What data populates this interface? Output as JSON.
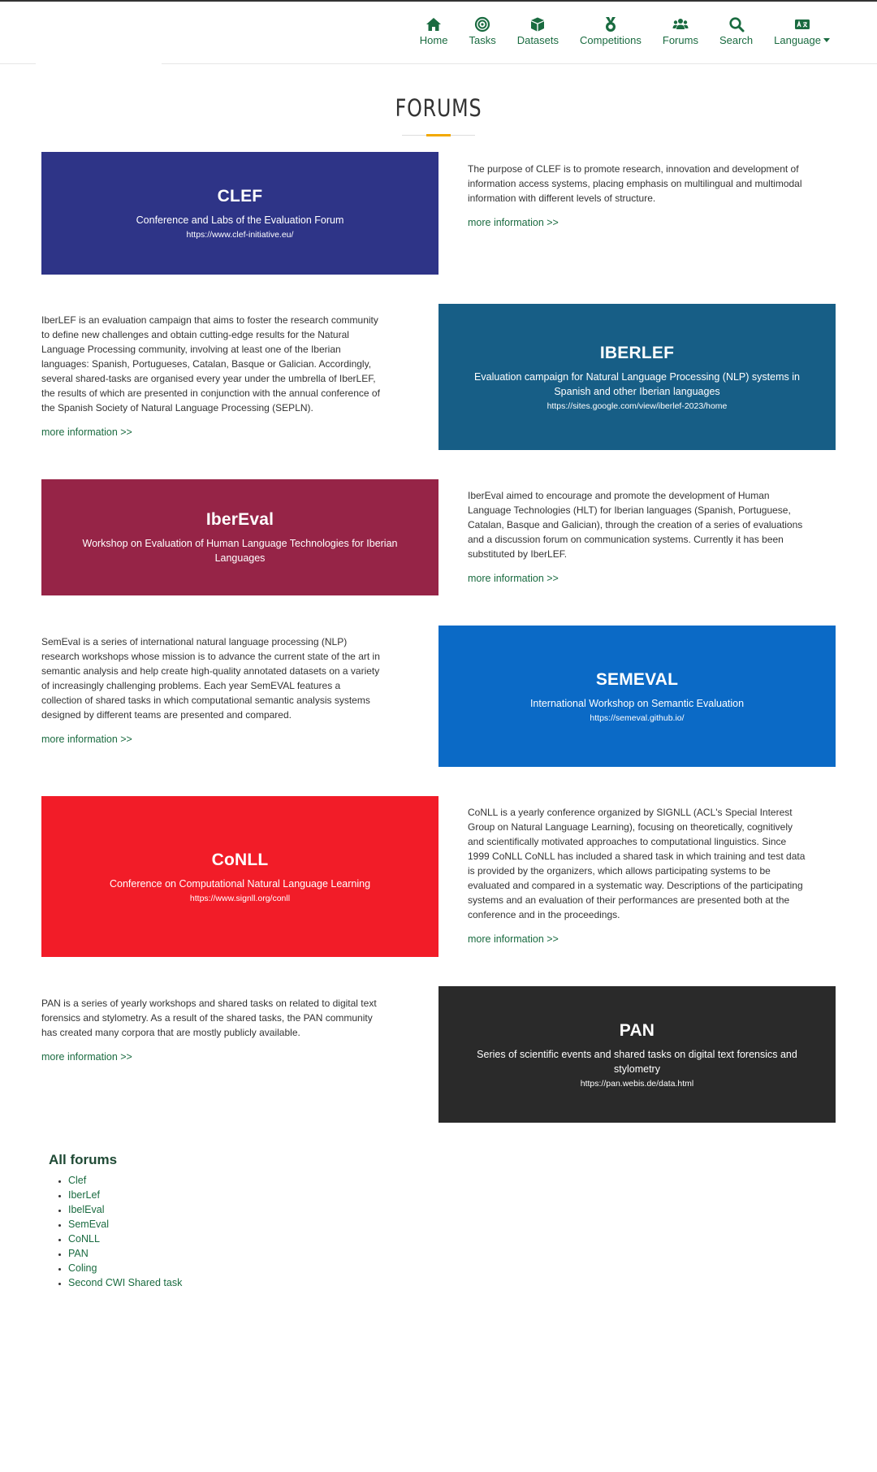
{
  "nav": {
    "items": [
      {
        "label": "Home",
        "icon": "home-icon"
      },
      {
        "label": "Tasks",
        "icon": "target-icon"
      },
      {
        "label": "Datasets",
        "icon": "cube-icon"
      },
      {
        "label": "Competitions",
        "icon": "medal-icon"
      },
      {
        "label": "Forums",
        "icon": "users-icon"
      },
      {
        "label": "Search",
        "icon": "search-icon"
      },
      {
        "label": "Language",
        "icon": "language-icon"
      }
    ]
  },
  "page": {
    "title": "FORUMS"
  },
  "forums": [
    {
      "name": "CLEF",
      "subtitle": "Conference and Labs of the Evaluation Forum",
      "url": "https://www.clef-initiative.eu/",
      "color": "#2e3487",
      "description": "The purpose of CLEF is to promote research, innovation and development of information access systems, placing emphasis on multilingual and multimodal information with different levels of structure.",
      "more": "more information >>"
    },
    {
      "name": "IBERLEF",
      "subtitle": "Evaluation campaign for Natural Language Processing (NLP) systems in Spanish and other Iberian languages",
      "url": "https://sites.google.com/view/iberlef-2023/home",
      "color": "#175e86",
      "description": "IberLEF is an evaluation campaign that aims to foster the research community to define new challenges and obtain cutting-edge results for the Natural Language Processing community, involving at least one of the Iberian languages: Spanish, Portugueses, Catalan, Basque or Galician. Accordingly, several shared-tasks are organised every year under the umbrella of IberLEF, the results of which are presented in conjunction with the annual conference of the Spanish Society of Natural Language Processing (SEPLN).",
      "more": "more information >>"
    },
    {
      "name": "IberEval",
      "subtitle": "Workshop on Evaluation of Human Language Technologies for Iberian Languages",
      "url": "",
      "color": "#962447",
      "description": "IberEval aimed to encourage and promote the development of Human Language Technologies (HLT) for Iberian languages (Spanish, Portuguese, Catalan, Basque and Galician), through the creation of a series of evaluations and a discussion forum on communication systems. Currently it has been substituted by IberLEF.",
      "more": "more information >>"
    },
    {
      "name": "SEMEVAL",
      "subtitle": "International Workshop on Semantic Evaluation",
      "url": "https://semeval.github.io/",
      "color": "#0b6ac6",
      "description": "SemEval is a series of international natural language processing (NLP) research workshops whose mission is to advance the current state of the art in semantic analysis and help create high-quality annotated datasets on a variety of increasingly challenging problems. Each year SemEVAL features a collection of shared tasks in which computational semantic analysis systems designed by different teams are presented and compared.",
      "more": "more information >>"
    },
    {
      "name": "CoNLL",
      "subtitle": "Conference on Computational Natural Language Learning",
      "url": "https://www.signll.org/conll",
      "color": "#f21c28",
      "description": "CoNLL is a yearly conference organized by SIGNLL (ACL's Special Interest Group on Natural Language Learning), focusing on theoretically, cognitively and scientifically motivated approaches to computational linguistics. Since 1999 CoNLL CoNLL has included a shared task in which training and test data is provided by the organizers, which allows participating systems to be evaluated and compared in a systematic way. Descriptions of the participating systems and an evaluation of their performances are presented both at the conference and in the proceedings.",
      "more": "more information >>"
    },
    {
      "name": "PAN",
      "subtitle": "Series of scientific events and shared tasks on digital text forensics and stylometry",
      "url": "https://pan.webis.de/data.html",
      "color": "#2a2a2a",
      "description": "PAN is a series of yearly workshops and shared tasks on related to digital text forensics and stylometry. As a result of the shared tasks, the PAN community has created many corpora that are mostly publicly available.",
      "more": "more information >>"
    }
  ],
  "all_forums": {
    "title": "All forums",
    "items": [
      "Clef",
      "IberLef",
      "IbelEval",
      "SemEval",
      "CoNLL",
      "PAN",
      "Coling",
      "Second CWI Shared task"
    ]
  }
}
